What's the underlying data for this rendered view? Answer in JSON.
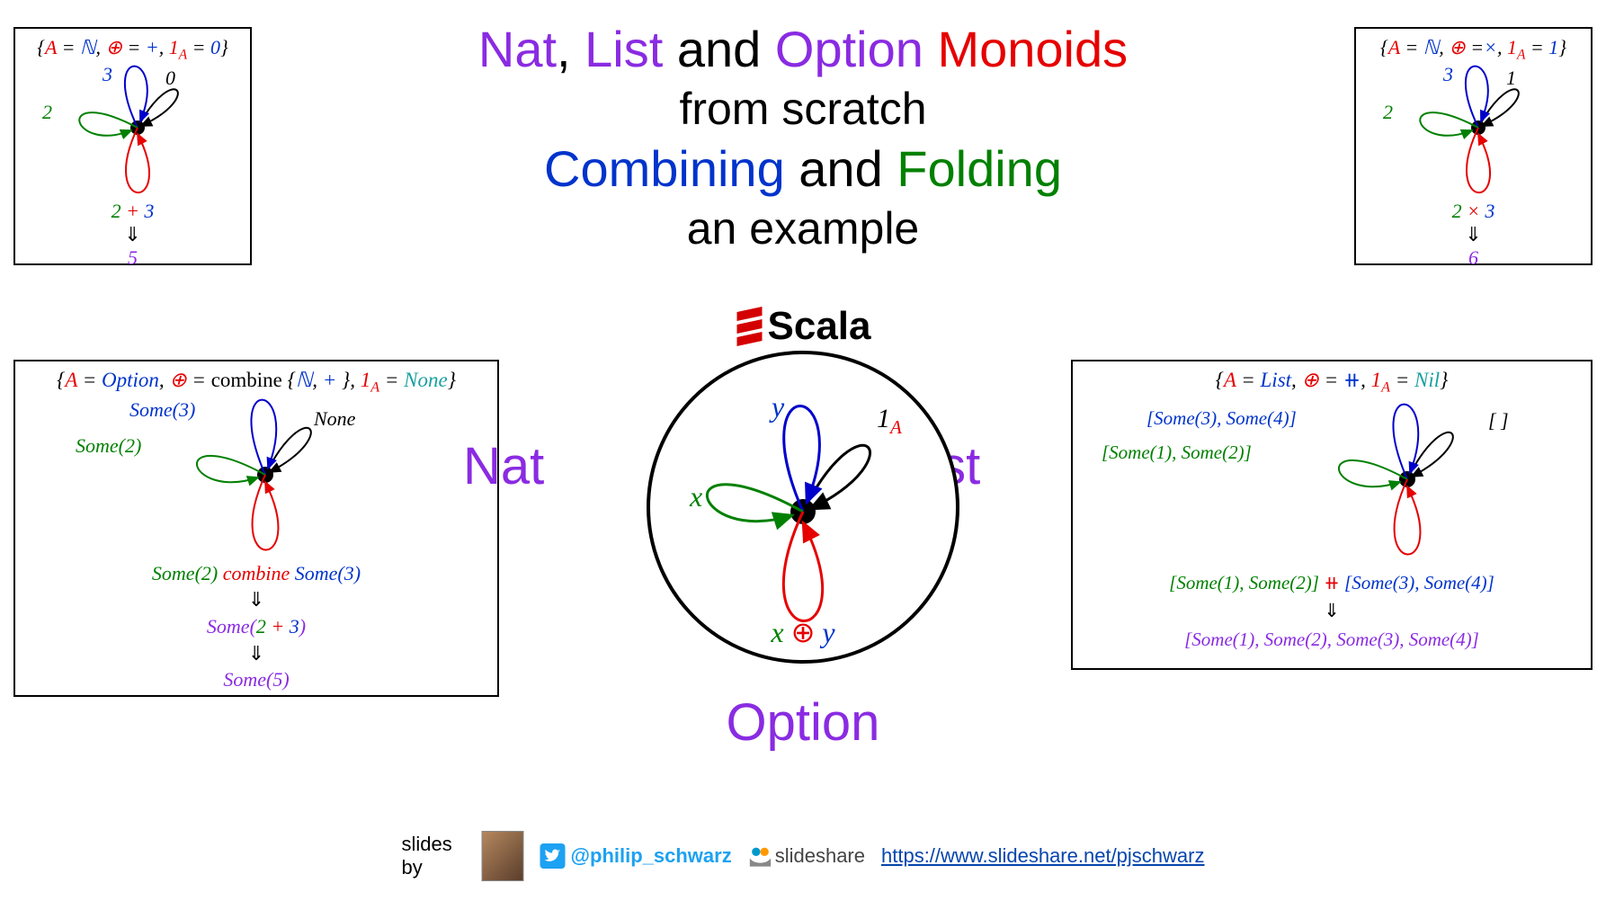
{
  "title": {
    "l1_nat": "Nat",
    "l1_comma1": ", ",
    "l1_list": "List",
    "l1_and": " and ",
    "l1_option": "Option",
    "l1_mon": " Monoids",
    "l2": "from scratch",
    "l3_combining": "Combining",
    "l3_and": " and ",
    "l3_folding": "Folding",
    "l4": "an example"
  },
  "labels": {
    "nat": "Nat",
    "list": "List",
    "option": "Option"
  },
  "scala": "Scala",
  "box_topleft": {
    "header_a": "A",
    "header_eq": " = ",
    "header_N": "ℕ",
    "header_c": ", ",
    "header_op": "⊕",
    "header_eq2": " = ",
    "header_plus": "+",
    "header_c2": ", ",
    "header_id": "1",
    "header_sub": "A",
    "header_eq3": " = ",
    "header_zero": "0",
    "v0": "0",
    "v3": "3",
    "v2": "2",
    "expr_l": "2",
    "expr_op": " + ",
    "expr_r": "3",
    "arr": "⇓",
    "res": "5"
  },
  "box_topright": {
    "header_a": "A",
    "header_eq": " = ",
    "header_N": "ℕ",
    "header_c": ", ",
    "header_op": "⊕",
    "header_eq2": " =",
    "header_times": "×",
    "header_c2": ", ",
    "header_id": "1",
    "header_sub": "A",
    "header_eq3": " = ",
    "header_one": "1",
    "v1": "1",
    "v3": "3",
    "v2": "2",
    "expr_l": "2",
    "expr_op": " × ",
    "expr_r": "3",
    "arr": "⇓",
    "res": "6"
  },
  "box_option": {
    "h_a": "A",
    "h_eq": " = ",
    "h_opt": "Option",
    "h_c": ", ",
    "h_op": "⊕",
    "h_eq2": " = ",
    "h_comb": "combine",
    "h_sp": " {",
    "h_N": "ℕ",
    "h_c2": ", ",
    "h_plus": "+",
    "h_sp2": " }, ",
    "h_id": "1",
    "h_sub": "A",
    "h_eq3": " = ",
    "h_none": "None",
    "v_none": "None",
    "v_some3": "Some(3)",
    "v_some2": "Some(2)",
    "e1_l": "Some(2)",
    "e1_op": " combine ",
    "e1_r": "Some(3)",
    "arr": "⇓",
    "e2_pre": "Some",
    "e2_open": "(",
    "e2_l": "2",
    "e2_op": " + ",
    "e2_r": "3",
    "e2_close": ")",
    "e3": "Some(5)"
  },
  "box_list": {
    "h_a": "A",
    "h_eq": " = ",
    "h_list": "List",
    "h_c": ", ",
    "h_op": "⊕",
    "h_eq2": " = ",
    "h_concat": "⧺",
    "h_c2": ", ",
    "h_id": "1",
    "h_sub": "A",
    "h_eq3": " = ",
    "h_nil": "Nil",
    "v_empty": "[ ]",
    "v_top": "[Some(3), Some(4)]",
    "v_left": "[Some(1), Some(2)]",
    "e1_l": "[Some(1), Some(2)]",
    "e1_op": " ⧺ ",
    "e1_r": "[Some(3), Some(4)]",
    "arr": "⇓",
    "e2": "[Some(1), Some(2), Some(3), Some(4)]"
  },
  "central": {
    "x": "x",
    "y": "y",
    "id": "1",
    "sub": "A",
    "expr_x": "x",
    "expr_op": " ⊕ ",
    "expr_y": "y"
  },
  "footer": {
    "by": "slides by",
    "handle": "@philip_schwarz",
    "ss": "slideshare",
    "url": "https://www.slideshare.net/pjschwarz"
  },
  "colors": {
    "purple": "#8a2be2",
    "red": "#e60000",
    "blue": "#0033cc",
    "green": "#008000",
    "black": "#000000",
    "cyan": "#1aa0a0"
  }
}
